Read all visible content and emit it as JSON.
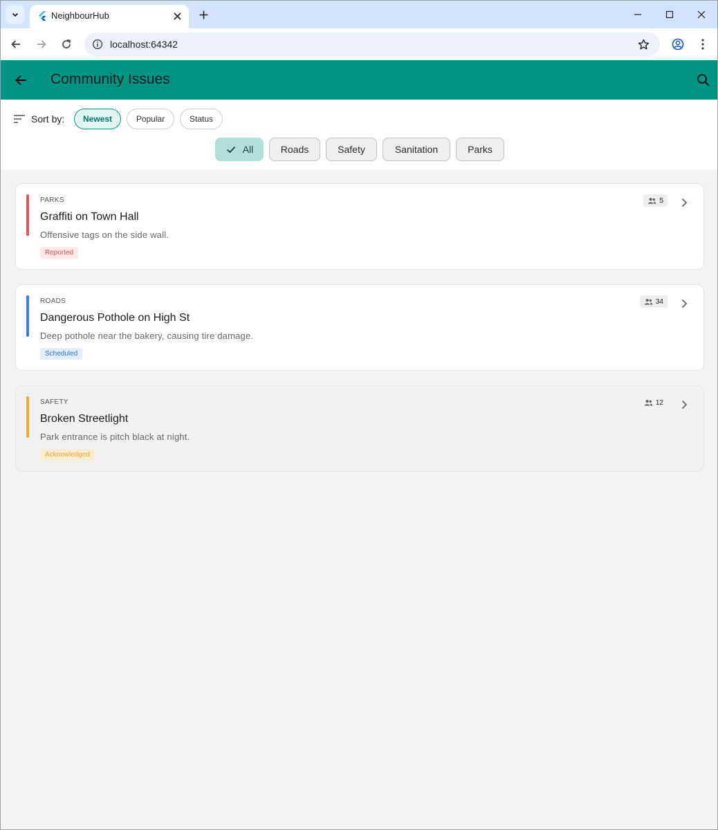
{
  "browser": {
    "tab_title": "NeighbourHub",
    "url": "localhost:64342"
  },
  "appbar": {
    "title": "Community Issues"
  },
  "sort": {
    "label": "Sort by:",
    "options": [
      "Newest",
      "Popular",
      "Status"
    ],
    "selected": "Newest"
  },
  "categories": {
    "options": [
      "All",
      "Roads",
      "Safety",
      "Sanitation",
      "Parks"
    ],
    "selected": "All"
  },
  "issues": [
    {
      "category": "PARKS",
      "title": "Graffiti on Town Hall",
      "description": "Offensive tags on the side wall.",
      "status": "Reported",
      "count": "5",
      "accent_color": "#e05656",
      "status_bg": "#fde7e7",
      "status_color": "#d9534f"
    },
    {
      "category": "ROADS",
      "title": "Dangerous Pothole on High St",
      "description": "Deep pothole near the bakery, causing tire damage.",
      "status": "Scheduled",
      "count": "34",
      "accent_color": "#3b7ddd",
      "status_bg": "#e3eefc",
      "status_color": "#2f6fd6"
    },
    {
      "category": "SAFETY",
      "title": "Broken Streetlight",
      "description": "Park entrance is pitch black at night.",
      "status": "Acknowledged",
      "count": "12",
      "accent_color": "#f0a833",
      "status_bg": "#fdeed3",
      "status_color": "#f0a02a"
    }
  ],
  "colors": {
    "primary": "#009485",
    "chrome_tabbar": "#d3e3fd"
  }
}
